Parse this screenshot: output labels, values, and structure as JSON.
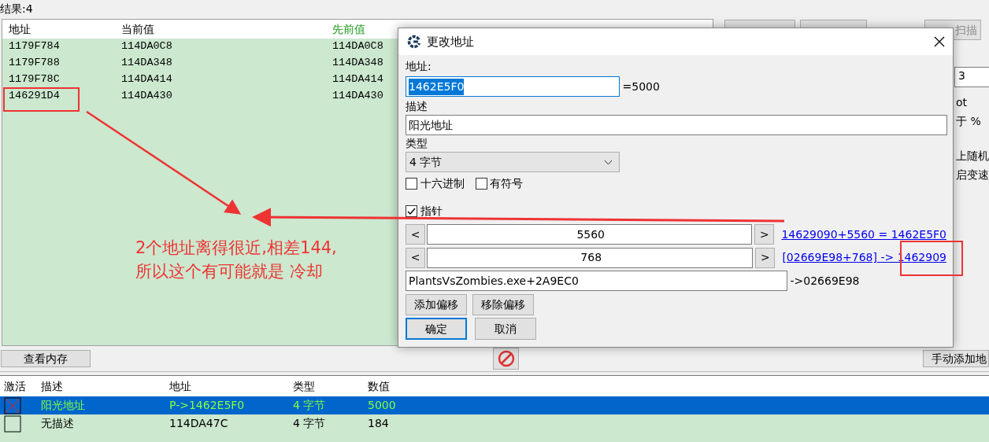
{
  "result_count": "结果:4",
  "results": {
    "columns": [
      {
        "label": "地址",
        "highlighted": false
      },
      {
        "label": "当前值",
        "highlighted": false
      },
      {
        "label": "先前值",
        "highlighted": true
      }
    ],
    "rows": [
      [
        "1179F784",
        "114DA0C8",
        "114DA0C8"
      ],
      [
        "1179F788",
        "114DA348",
        "114DA348"
      ],
      [
        "1179F78C",
        "114DA414",
        "114DA414"
      ],
      [
        "146291D4",
        "114DA430",
        "114DA430"
      ]
    ]
  },
  "side_panel": {
    "scan_button": "扫描",
    "value": "3",
    "labels": [
      "ot",
      "于 %",
      "上随机",
      "启变速"
    ]
  },
  "view_memory_button": "查看内存",
  "add_address_button": "手动添加地",
  "address_list": {
    "active_column": "激活",
    "columns": [
      "描述",
      "地址",
      "类型",
      "数值"
    ],
    "rows": [
      {
        "active": true,
        "selected": true,
        "cells": [
          "阳光地址",
          "P->1462E5F0",
          "4 字节",
          "5000"
        ]
      },
      {
        "active": false,
        "selected": false,
        "cells": [
          "无描述",
          "114DA47C",
          "4 字节",
          "184"
        ]
      }
    ]
  },
  "dialog": {
    "title": "更改地址",
    "address_label": "地址:",
    "address": "1462E5F0",
    "address_selected": true,
    "address_value": "=5000",
    "description_label": "描述",
    "description": "阳光地址",
    "type_label": "类型",
    "type": "4 字节",
    "options": [
      {
        "label": "十六进制",
        "checked": false
      },
      {
        "label": "有符号",
        "checked": false
      }
    ],
    "pointer": {
      "label": "指针",
      "checked": true
    },
    "offsets": [
      {
        "value": "5560",
        "result": "14629090+5560 = 1462E5F0"
      },
      {
        "value": "768",
        "result": "[02669E98+768] -> 1462909"
      }
    ],
    "offset_prev": "<",
    "offset_next": ">",
    "base": {
      "value": "PlantsVsZombies.exe+2A9EC0",
      "result": "->02669E98"
    },
    "offset_buttons": [
      "添加偏移",
      "移除偏移"
    ],
    "ok": "确定",
    "cancel": "取消"
  },
  "annotation": {
    "lines": [
      "2个地址离得很近,相差144,",
      "所以这个有可能就是 冷却"
    ]
  }
}
